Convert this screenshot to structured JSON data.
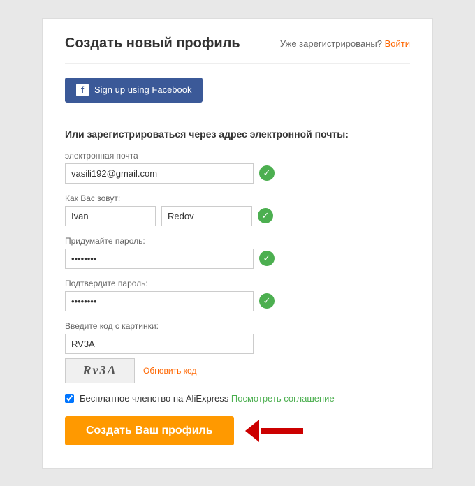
{
  "header": {
    "title": "Создать новый профиль",
    "already_text": "Уже зарегистрированы?",
    "login_link": "Войти"
  },
  "facebook": {
    "button_label": "Sign up using Facebook",
    "icon": "f"
  },
  "form": {
    "section_title": "Или зарегистрироваться через адрес электронной почты:",
    "email_label": "электронная почта",
    "email_value": "vasili192@gmail.com",
    "name_label": "Как Вас зовут:",
    "firstname_value": "Ivan",
    "lastname_value": "Redov",
    "password_label": "Придумайте пароль:",
    "password_value": "••••••••",
    "confirm_label": "Подтвердите пароль:",
    "confirm_value": "••••••••",
    "captcha_label": "Введите код с картинки:",
    "captcha_value": "RV3A",
    "captcha_display": "Rv3A",
    "refresh_label": "Обновить код",
    "terms_text": "Бесплатное членство на AliExpress",
    "terms_link": "Посмотреть соглашение",
    "submit_label": "Создать Ваш профиль"
  }
}
